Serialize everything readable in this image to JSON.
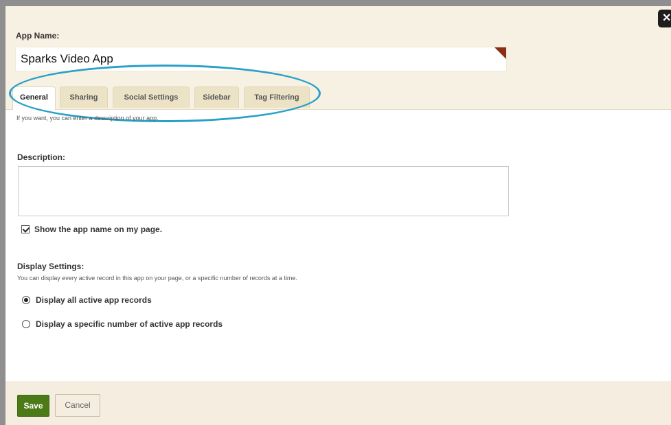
{
  "close": {
    "icon": "close-icon",
    "glyph": "✕"
  },
  "app_name": {
    "label": "App Name:",
    "value": "Sparks Video App"
  },
  "tabs": [
    {
      "label": "General",
      "active": true
    },
    {
      "label": "Sharing",
      "active": false
    },
    {
      "label": "Social Settings",
      "active": false
    },
    {
      "label": "Sidebar",
      "active": false
    },
    {
      "label": "Tag Filtering",
      "active": false
    }
  ],
  "general": {
    "hint": "If you want, you can enter a description of your app.",
    "description_label": "Description:",
    "description_value": "",
    "show_name_label": "Show the app name on my page.",
    "show_name_checked": true,
    "display_settings_label": "Display Settings:",
    "display_settings_desc": "You can display every active record in this app on your page, or a specific number of records at a time.",
    "options": [
      {
        "label": "Display all active app records",
        "selected": true
      },
      {
        "label": "Display a specific number of active app records",
        "selected": false
      }
    ]
  },
  "footer": {
    "save_label": "Save",
    "cancel_label": "Cancel"
  },
  "colors": {
    "save_bg": "#4c7a17",
    "header_bg": "#f6f1e2",
    "annotation": "#2aa0c7",
    "flag": "#8b2e16"
  }
}
